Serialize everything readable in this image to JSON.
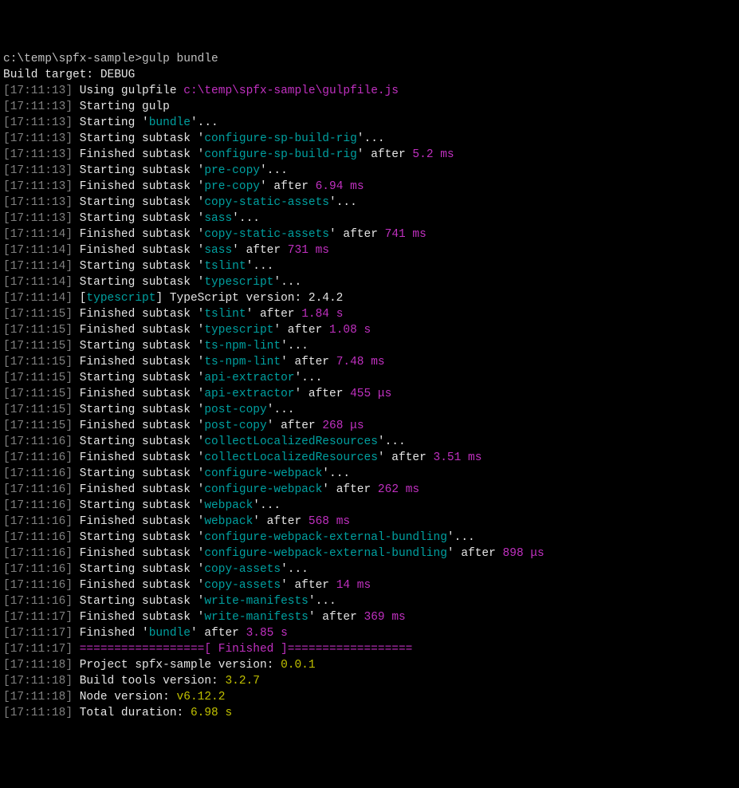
{
  "prompt": {
    "path": "c:\\temp\\spfx-sample>",
    "cmd": "gulp bundle"
  },
  "build_target_line": {
    "label": "Build target: ",
    "value": "DEBUG"
  },
  "lines": [
    {
      "ts": "17:11:13",
      "segs": [
        {
          "t": "Using gulpfile ",
          "c": "white"
        },
        {
          "t": "c:\\temp\\spfx-sample\\gulpfile.js",
          "c": "mag"
        }
      ]
    },
    {
      "ts": "17:11:13",
      "segs": [
        {
          "t": "Starting gulp",
          "c": "white"
        }
      ]
    },
    {
      "ts": "17:11:13",
      "segs": [
        {
          "t": "Starting '",
          "c": "white"
        },
        {
          "t": "bundle",
          "c": "cyan"
        },
        {
          "t": "'...",
          "c": "white"
        }
      ]
    },
    {
      "ts": "17:11:13",
      "segs": [
        {
          "t": "Starting subtask '",
          "c": "white"
        },
        {
          "t": "configure-sp-build-rig",
          "c": "cyan"
        },
        {
          "t": "'...",
          "c": "white"
        }
      ]
    },
    {
      "ts": "17:11:13",
      "segs": [
        {
          "t": "Finished subtask '",
          "c": "white"
        },
        {
          "t": "configure-sp-build-rig",
          "c": "cyan"
        },
        {
          "t": "' after ",
          "c": "white"
        },
        {
          "t": "5.2 ms",
          "c": "mag"
        }
      ]
    },
    {
      "ts": "17:11:13",
      "segs": [
        {
          "t": "Starting subtask '",
          "c": "white"
        },
        {
          "t": "pre-copy",
          "c": "cyan"
        },
        {
          "t": "'...",
          "c": "white"
        }
      ]
    },
    {
      "ts": "17:11:13",
      "segs": [
        {
          "t": "Finished subtask '",
          "c": "white"
        },
        {
          "t": "pre-copy",
          "c": "cyan"
        },
        {
          "t": "' after ",
          "c": "white"
        },
        {
          "t": "6.94 ms",
          "c": "mag"
        }
      ]
    },
    {
      "ts": "17:11:13",
      "segs": [
        {
          "t": "Starting subtask '",
          "c": "white"
        },
        {
          "t": "copy-static-assets",
          "c": "cyan"
        },
        {
          "t": "'...",
          "c": "white"
        }
      ]
    },
    {
      "ts": "17:11:13",
      "segs": [
        {
          "t": "Starting subtask '",
          "c": "white"
        },
        {
          "t": "sass",
          "c": "cyan"
        },
        {
          "t": "'...",
          "c": "white"
        }
      ]
    },
    {
      "ts": "17:11:14",
      "segs": [
        {
          "t": "Finished subtask '",
          "c": "white"
        },
        {
          "t": "copy-static-assets",
          "c": "cyan"
        },
        {
          "t": "' after ",
          "c": "white"
        },
        {
          "t": "741 ms",
          "c": "mag"
        }
      ]
    },
    {
      "ts": "17:11:14",
      "segs": [
        {
          "t": "Finished subtask '",
          "c": "white"
        },
        {
          "t": "sass",
          "c": "cyan"
        },
        {
          "t": "' after ",
          "c": "white"
        },
        {
          "t": "731 ms",
          "c": "mag"
        }
      ]
    },
    {
      "ts": "17:11:14",
      "segs": [
        {
          "t": "Starting subtask '",
          "c": "white"
        },
        {
          "t": "tslint",
          "c": "cyan"
        },
        {
          "t": "'...",
          "c": "white"
        }
      ]
    },
    {
      "ts": "17:11:14",
      "segs": [
        {
          "t": "Starting subtask '",
          "c": "white"
        },
        {
          "t": "typescript",
          "c": "cyan"
        },
        {
          "t": "'...",
          "c": "white"
        }
      ]
    },
    {
      "ts": "17:11:14",
      "segs": [
        {
          "t": "[",
          "c": "white"
        },
        {
          "t": "typescript",
          "c": "cyan"
        },
        {
          "t": "] TypeScript version: 2.4.2",
          "c": "white"
        }
      ]
    },
    {
      "ts": "17:11:15",
      "segs": [
        {
          "t": "Finished subtask '",
          "c": "white"
        },
        {
          "t": "tslint",
          "c": "cyan"
        },
        {
          "t": "' after ",
          "c": "white"
        },
        {
          "t": "1.84 s",
          "c": "mag"
        }
      ]
    },
    {
      "ts": "17:11:15",
      "segs": [
        {
          "t": "Finished subtask '",
          "c": "white"
        },
        {
          "t": "typescript",
          "c": "cyan"
        },
        {
          "t": "' after ",
          "c": "white"
        },
        {
          "t": "1.08 s",
          "c": "mag"
        }
      ]
    },
    {
      "ts": "17:11:15",
      "segs": [
        {
          "t": "Starting subtask '",
          "c": "white"
        },
        {
          "t": "ts-npm-lint",
          "c": "cyan"
        },
        {
          "t": "'...",
          "c": "white"
        }
      ]
    },
    {
      "ts": "17:11:15",
      "segs": [
        {
          "t": "Finished subtask '",
          "c": "white"
        },
        {
          "t": "ts-npm-lint",
          "c": "cyan"
        },
        {
          "t": "' after ",
          "c": "white"
        },
        {
          "t": "7.48 ms",
          "c": "mag"
        }
      ]
    },
    {
      "ts": "17:11:15",
      "segs": [
        {
          "t": "Starting subtask '",
          "c": "white"
        },
        {
          "t": "api-extractor",
          "c": "cyan"
        },
        {
          "t": "'...",
          "c": "white"
        }
      ]
    },
    {
      "ts": "17:11:15",
      "segs": [
        {
          "t": "Finished subtask '",
          "c": "white"
        },
        {
          "t": "api-extractor",
          "c": "cyan"
        },
        {
          "t": "' after ",
          "c": "white"
        },
        {
          "t": "455 μs",
          "c": "mag"
        }
      ]
    },
    {
      "ts": "17:11:15",
      "segs": [
        {
          "t": "Starting subtask '",
          "c": "white"
        },
        {
          "t": "post-copy",
          "c": "cyan"
        },
        {
          "t": "'...",
          "c": "white"
        }
      ]
    },
    {
      "ts": "17:11:15",
      "segs": [
        {
          "t": "Finished subtask '",
          "c": "white"
        },
        {
          "t": "post-copy",
          "c": "cyan"
        },
        {
          "t": "' after ",
          "c": "white"
        },
        {
          "t": "268 μs",
          "c": "mag"
        }
      ]
    },
    {
      "ts": "17:11:16",
      "segs": [
        {
          "t": "Starting subtask '",
          "c": "white"
        },
        {
          "t": "collectLocalizedResources",
          "c": "cyan"
        },
        {
          "t": "'...",
          "c": "white"
        }
      ]
    },
    {
      "ts": "17:11:16",
      "segs": [
        {
          "t": "Finished subtask '",
          "c": "white"
        },
        {
          "t": "collectLocalizedResources",
          "c": "cyan"
        },
        {
          "t": "' after ",
          "c": "white"
        },
        {
          "t": "3.51 ms",
          "c": "mag"
        }
      ]
    },
    {
      "ts": "17:11:16",
      "segs": [
        {
          "t": "Starting subtask '",
          "c": "white"
        },
        {
          "t": "configure-webpack",
          "c": "cyan"
        },
        {
          "t": "'...",
          "c": "white"
        }
      ]
    },
    {
      "ts": "17:11:16",
      "segs": [
        {
          "t": "Finished subtask '",
          "c": "white"
        },
        {
          "t": "configure-webpack",
          "c": "cyan"
        },
        {
          "t": "' after ",
          "c": "white"
        },
        {
          "t": "262 ms",
          "c": "mag"
        }
      ]
    },
    {
      "ts": "17:11:16",
      "segs": [
        {
          "t": "Starting subtask '",
          "c": "white"
        },
        {
          "t": "webpack",
          "c": "cyan"
        },
        {
          "t": "'...",
          "c": "white"
        }
      ]
    },
    {
      "ts": "17:11:16",
      "segs": [
        {
          "t": "Finished subtask '",
          "c": "white"
        },
        {
          "t": "webpack",
          "c": "cyan"
        },
        {
          "t": "' after ",
          "c": "white"
        },
        {
          "t": "568 ms",
          "c": "mag"
        }
      ]
    },
    {
      "ts": "17:11:16",
      "segs": [
        {
          "t": "Starting subtask '",
          "c": "white"
        },
        {
          "t": "configure-webpack-external-bundling",
          "c": "cyan"
        },
        {
          "t": "'...",
          "c": "white"
        }
      ]
    },
    {
      "ts": "17:11:16",
      "segs": [
        {
          "t": "Finished subtask '",
          "c": "white"
        },
        {
          "t": "configure-webpack-external-bundling",
          "c": "cyan"
        },
        {
          "t": "' after ",
          "c": "white"
        },
        {
          "t": "898 μs",
          "c": "mag"
        }
      ]
    },
    {
      "ts": "17:11:16",
      "segs": [
        {
          "t": "Starting subtask '",
          "c": "white"
        },
        {
          "t": "copy-assets",
          "c": "cyan"
        },
        {
          "t": "'...",
          "c": "white"
        }
      ]
    },
    {
      "ts": "17:11:16",
      "segs": [
        {
          "t": "Finished subtask '",
          "c": "white"
        },
        {
          "t": "copy-assets",
          "c": "cyan"
        },
        {
          "t": "' after ",
          "c": "white"
        },
        {
          "t": "14 ms",
          "c": "mag"
        }
      ]
    },
    {
      "ts": "17:11:16",
      "segs": [
        {
          "t": "Starting subtask '",
          "c": "white"
        },
        {
          "t": "write-manifests",
          "c": "cyan"
        },
        {
          "t": "'...",
          "c": "white"
        }
      ]
    },
    {
      "ts": "17:11:17",
      "segs": [
        {
          "t": "Finished subtask '",
          "c": "white"
        },
        {
          "t": "write-manifests",
          "c": "cyan"
        },
        {
          "t": "' after ",
          "c": "white"
        },
        {
          "t": "369 ms",
          "c": "mag"
        }
      ]
    },
    {
      "ts": "17:11:17",
      "segs": [
        {
          "t": "Finished '",
          "c": "white"
        },
        {
          "t": "bundle",
          "c": "cyan"
        },
        {
          "t": "' after ",
          "c": "white"
        },
        {
          "t": "3.85 s",
          "c": "mag"
        }
      ]
    },
    {
      "ts": "17:11:17",
      "segs": [
        {
          "t": "==================[ Finished ]==================",
          "c": "mag"
        }
      ]
    },
    {
      "ts": "17:11:18",
      "segs": [
        {
          "t": "Project spfx-sample version: ",
          "c": "white"
        },
        {
          "t": "0.0.1",
          "c": "yell"
        }
      ]
    },
    {
      "ts": "17:11:18",
      "segs": [
        {
          "t": "Build tools version: ",
          "c": "white"
        },
        {
          "t": "3.2.7",
          "c": "yell"
        }
      ]
    },
    {
      "ts": "17:11:18",
      "segs": [
        {
          "t": "Node version: ",
          "c": "white"
        },
        {
          "t": "v6.12.2",
          "c": "yell"
        }
      ]
    },
    {
      "ts": "17:11:18",
      "segs": [
        {
          "t": "Total duration: ",
          "c": "white"
        },
        {
          "t": "6.98 s",
          "c": "yell"
        }
      ]
    }
  ]
}
